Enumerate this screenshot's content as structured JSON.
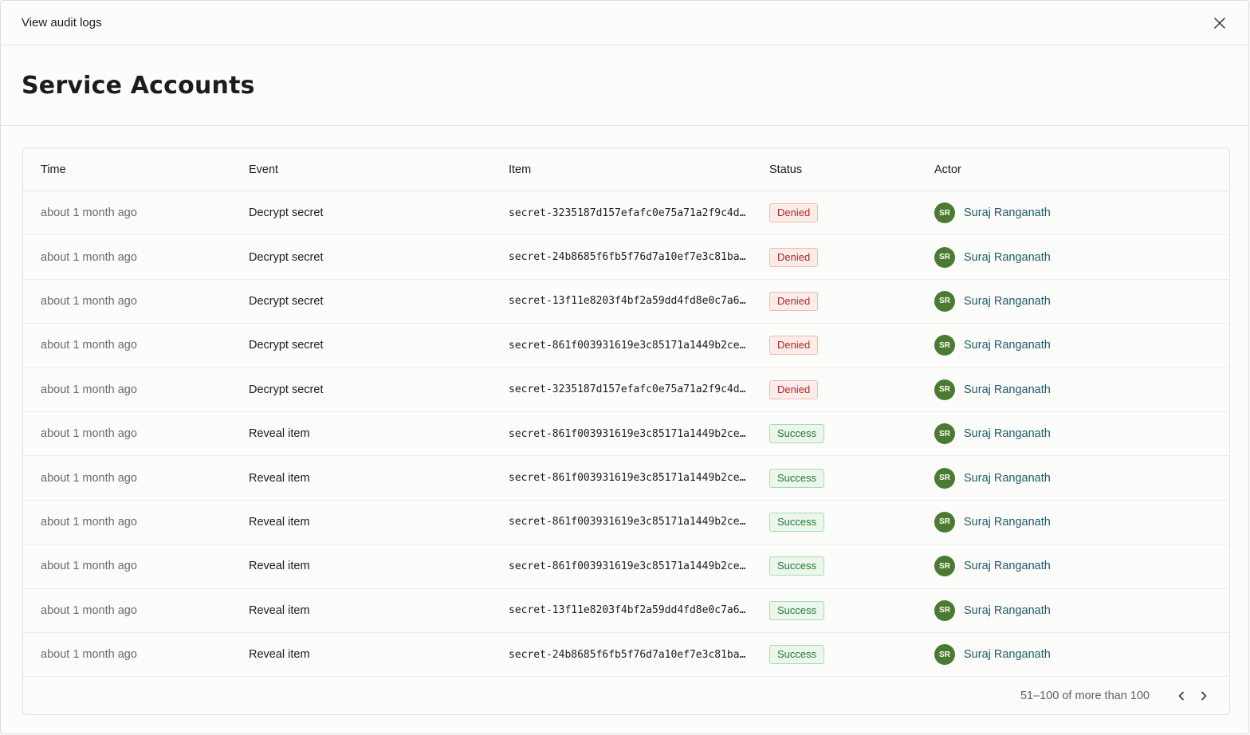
{
  "modal": {
    "title": "View audit logs",
    "close_icon": "close-icon"
  },
  "page": {
    "title": "Service Accounts"
  },
  "colors": {
    "denied_text": "#b3261e",
    "denied_bg": "#fdecea",
    "success_text": "#1e7a2e",
    "success_bg": "#ebf7ec",
    "avatar_bg": "#4b7a33",
    "actor_link": "#1f5a66"
  },
  "table": {
    "columns": [
      "Time",
      "Event",
      "Item",
      "Status",
      "Actor"
    ],
    "rows": [
      {
        "time": "about 1 month ago",
        "event": "Decrypt secret",
        "item": "secret-3235187d157efafc0e75a71a2f9c4d…",
        "status": "Denied",
        "status_kind": "denied",
        "actor_initials": "SR",
        "actor": "Suraj Ranganath"
      },
      {
        "time": "about 1 month ago",
        "event": "Decrypt secret",
        "item": "secret-24b8685f6fb5f76d7a10ef7e3c81ba…",
        "status": "Denied",
        "status_kind": "denied",
        "actor_initials": "SR",
        "actor": "Suraj Ranganath"
      },
      {
        "time": "about 1 month ago",
        "event": "Decrypt secret",
        "item": "secret-13f11e8203f4bf2a59dd4fd8e0c7a6…",
        "status": "Denied",
        "status_kind": "denied",
        "actor_initials": "SR",
        "actor": "Suraj Ranganath"
      },
      {
        "time": "about 1 month ago",
        "event": "Decrypt secret",
        "item": "secret-861f003931619e3c85171a1449b2ce…",
        "status": "Denied",
        "status_kind": "denied",
        "actor_initials": "SR",
        "actor": "Suraj Ranganath"
      },
      {
        "time": "about 1 month ago",
        "event": "Decrypt secret",
        "item": "secret-3235187d157efafc0e75a71a2f9c4d…",
        "status": "Denied",
        "status_kind": "denied",
        "actor_initials": "SR",
        "actor": "Suraj Ranganath"
      },
      {
        "time": "about 1 month ago",
        "event": "Reveal item",
        "item": "secret-861f003931619e3c85171a1449b2ce…",
        "status": "Success",
        "status_kind": "success",
        "actor_initials": "SR",
        "actor": "Suraj Ranganath"
      },
      {
        "time": "about 1 month ago",
        "event": "Reveal item",
        "item": "secret-861f003931619e3c85171a1449b2ce…",
        "status": "Success",
        "status_kind": "success",
        "actor_initials": "SR",
        "actor": "Suraj Ranganath"
      },
      {
        "time": "about 1 month ago",
        "event": "Reveal item",
        "item": "secret-861f003931619e3c85171a1449b2ce…",
        "status": "Success",
        "status_kind": "success",
        "actor_initials": "SR",
        "actor": "Suraj Ranganath"
      },
      {
        "time": "about 1 month ago",
        "event": "Reveal item",
        "item": "secret-861f003931619e3c85171a1449b2ce…",
        "status": "Success",
        "status_kind": "success",
        "actor_initials": "SR",
        "actor": "Suraj Ranganath"
      },
      {
        "time": "about 1 month ago",
        "event": "Reveal item",
        "item": "secret-13f11e8203f4bf2a59dd4fd8e0c7a6…",
        "status": "Success",
        "status_kind": "success",
        "actor_initials": "SR",
        "actor": "Suraj Ranganath"
      },
      {
        "time": "about 1 month ago",
        "event": "Reveal item",
        "item": "secret-24b8685f6fb5f76d7a10ef7e3c81ba…",
        "status": "Success",
        "status_kind": "success",
        "actor_initials": "SR",
        "actor": "Suraj Ranganath"
      }
    ]
  },
  "pagination": {
    "range_text": "51–100 of more than 100",
    "prev_icon": "chevron-left-icon",
    "next_icon": "chevron-right-icon"
  }
}
